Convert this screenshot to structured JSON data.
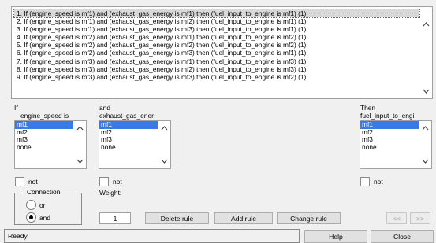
{
  "rules": [
    "1. If (engine_speed is mf1) and (exhaust_gas_energy is mf1) then (fuel_input_to_engine is mf1) (1)",
    "2. If (engine_speed is mf1) and (exhaust_gas_energy is mf2) then (fuel_input_to_engine is mf1) (1)",
    "3. If (engine_speed is mf1) and (exhaust_gas_energy is mf3) then (fuel_input_to_engine is mf1) (1)",
    "4. If (engine_speed is mf2) and (exhaust_gas_energy is mf1) then (fuel_input_to_engine is mf2) (1)",
    "5. If (engine_speed is mf2) and (exhaust_gas_energy is mf2) then (fuel_input_to_engine is mf2) (1)",
    "6. If (engine_speed is mf2) and (exhaust_gas_energy is mf3) then (fuel_input_to_engine is mf1) (1)",
    "7. If (engine_speed is mf3) and (exhaust_gas_energy is mf1) then (fuel_input_to_engine is mf3) (1)",
    "8. If (engine_speed is mf3) and (exhaust_gas_energy is mf2) then (fuel_input_to_engine is mf3) (1)",
    "9. If (engine_speed is mf3) and (exhaust_gas_energy is mf3) then (fuel_input_to_engine is mf2) (1)"
  ],
  "input1": {
    "header": "If",
    "name": "engine_speed is",
    "items": [
      "mf1",
      "mf2",
      "mf3",
      "none"
    ],
    "not_label": "not"
  },
  "input2": {
    "header": "and",
    "name": "exhaust_gas_ener",
    "items": [
      "mf1",
      "mf2",
      "mf3",
      "none"
    ],
    "not_label": "not"
  },
  "output": {
    "header": "Then",
    "name": "fuel_input_to_engi",
    "items": [
      "mf1",
      "mf2",
      "mf3",
      "none"
    ],
    "not_label": "not"
  },
  "connection": {
    "title": "Connection",
    "options": [
      "or",
      "and"
    ],
    "selected": "and"
  },
  "weight": {
    "label": "Weight:",
    "value": "1"
  },
  "buttons": {
    "delete_rule": "Delete rule",
    "add_rule": "Add rule",
    "change_rule": "Change rule",
    "prev": "<<",
    "next": ">>",
    "help": "Help",
    "close": "Close"
  },
  "status": "Ready",
  "colors": {
    "selection": "#3a7ae6",
    "background": "#f0f0f0"
  }
}
